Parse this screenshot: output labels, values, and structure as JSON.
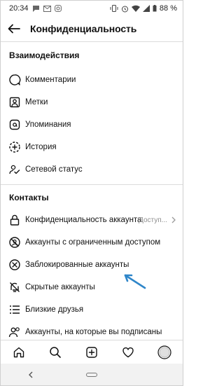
{
  "status": {
    "time": "20:34",
    "battery": "88 %"
  },
  "header": {
    "title": "Конфиденциальность"
  },
  "sections": {
    "interactions": {
      "title": "Взаимодействия",
      "items": [
        {
          "label": "Комментарии",
          "icon": "comment-icon"
        },
        {
          "label": "Метки",
          "icon": "tag-icon"
        },
        {
          "label": "Упоминания",
          "icon": "at-icon"
        },
        {
          "label": "История",
          "icon": "story-icon"
        },
        {
          "label": "Сетевой статус",
          "icon": "activity-status-icon"
        }
      ]
    },
    "contacts": {
      "title": "Контакты",
      "items": [
        {
          "label": "Конфиденциальность аккаунта",
          "value": "Доступ...",
          "icon": "lock-icon"
        },
        {
          "label": "Аккаунты с ограниченным доступом",
          "icon": "restricted-icon"
        },
        {
          "label": "Заблокированные аккаунты",
          "icon": "blocked-icon"
        },
        {
          "label": "Скрытые аккаунты",
          "icon": "muted-icon"
        },
        {
          "label": "Близкие друзья",
          "icon": "close-friends-icon"
        },
        {
          "label": "Аккаунты, на которые вы подписаны",
          "icon": "following-icon"
        }
      ]
    }
  },
  "colors": {
    "accent_arrow": "#2f86c9",
    "divider": "#dcdcdc"
  }
}
